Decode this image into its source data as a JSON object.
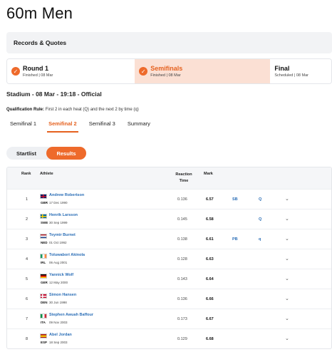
{
  "title": "60m Men",
  "records_label": "Records & Quotes",
  "rounds": [
    {
      "name": "Round 1",
      "status": "Finished | 08 Mar",
      "done": true
    },
    {
      "name": "Semifinals",
      "status": "Finished | 08 Mar",
      "done": true
    },
    {
      "name": "Final",
      "status": "Scheduled | 08 Mar",
      "done": false
    }
  ],
  "session": "Stadium - 08 Mar - 19:18 - Official",
  "qualification": {
    "label": "Qualification Rule:",
    "text": "First 2 in each heat (Q) and the next 2 by time (q)"
  },
  "tabs": [
    "Semifinal 1",
    "Semifinal 2",
    "Semifinal 3",
    "Summary"
  ],
  "toggle": {
    "startlist": "Startlist",
    "results": "Results"
  },
  "table": {
    "headers": {
      "rank": "Rank",
      "athlete": "Athlete",
      "reaction": "Reaction Time",
      "mark": "Mark"
    },
    "rows": [
      {
        "rank": "1",
        "name": "Andrew Robertson",
        "country": "GBR",
        "dob": "17 Dec 1990",
        "reaction": "0.136",
        "mark": "6.57",
        "record": "SB",
        "qual": "Q"
      },
      {
        "rank": "2",
        "name": "Henrik Larsson",
        "country": "SWE",
        "dob": "30 Sep 1999",
        "reaction": "0.145",
        "mark": "6.58",
        "record": "",
        "qual": "Q"
      },
      {
        "rank": "3",
        "name": "Teymir Burnet",
        "country": "NED",
        "dob": "01 Oct 1992",
        "reaction": "0.138",
        "mark": "6.61",
        "record": "PB",
        "qual": "q"
      },
      {
        "rank": "4",
        "name": "Toluwabori Akinola",
        "country": "IRL",
        "dob": "06 Aug 2001",
        "reaction": "0.128",
        "mark": "6.63",
        "record": "",
        "qual": ""
      },
      {
        "rank": "5",
        "name": "Yannick Wolf",
        "country": "GER",
        "dob": "12 May 2000",
        "reaction": "0.143",
        "mark": "6.64",
        "record": "",
        "qual": ""
      },
      {
        "rank": "6",
        "name": "Simon Hansen",
        "country": "DEN",
        "dob": "30 Jun 1998",
        "reaction": "0.136",
        "mark": "6.66",
        "record": "",
        "qual": ""
      },
      {
        "rank": "7",
        "name": "Stephen Awuah Baffour",
        "country": "ITA",
        "dob": "09 Nov 2003",
        "reaction": "0.173",
        "mark": "6.67",
        "record": "",
        "qual": ""
      },
      {
        "rank": "8",
        "name": "Abel Jordan",
        "country": "ESP",
        "dob": "18 Sep 2003",
        "reaction": "0.129",
        "mark": "6.68",
        "record": "",
        "qual": ""
      }
    ]
  }
}
